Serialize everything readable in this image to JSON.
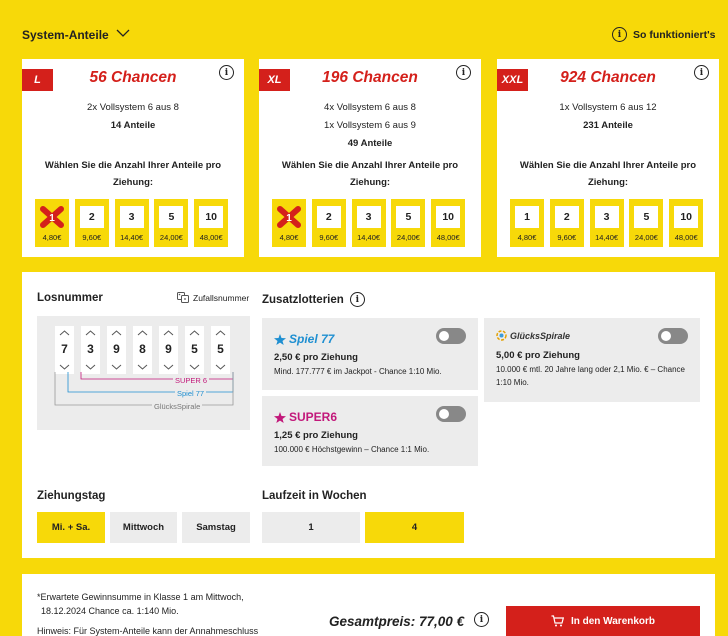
{
  "header": {
    "title": "System-Anteile",
    "howto_label": "So funktioniert's"
  },
  "cards": [
    {
      "badge": "L",
      "title": "56 Chancen",
      "lines": [
        "2x Vollsystem 6 aus 8"
      ],
      "shares_total": "14 Anteile",
      "question": "Wählen Sie die Anzahl Ihrer Anteile pro Ziehung:",
      "options": [
        {
          "n": "1",
          "price": "4,80€"
        },
        {
          "n": "2",
          "price": "9,60€"
        },
        {
          "n": "3",
          "price": "14,40€"
        },
        {
          "n": "5",
          "price": "24,00€"
        },
        {
          "n": "10",
          "price": "48,00€"
        }
      ]
    },
    {
      "badge": "XL",
      "title": "196 Chancen",
      "lines": [
        "4x Vollsystem 6 aus 8",
        "1x Vollsystem 6 aus 9"
      ],
      "shares_total": "49 Anteile",
      "question": "Wählen Sie die Anzahl Ihrer Anteile pro Ziehung:",
      "options": [
        {
          "n": "1",
          "price": "4,80€"
        },
        {
          "n": "2",
          "price": "9,60€"
        },
        {
          "n": "3",
          "price": "14,40€"
        },
        {
          "n": "5",
          "price": "24,00€"
        },
        {
          "n": "10",
          "price": "48,00€"
        }
      ]
    },
    {
      "badge": "XXL",
      "title": "924 Chancen",
      "lines": [
        "1x Vollsystem 6 aus 12"
      ],
      "shares_total": "231 Anteile",
      "question": "Wählen Sie die Anzahl Ihrer Anteile pro Ziehung:",
      "options": [
        {
          "n": "1",
          "price": "4,80€"
        },
        {
          "n": "2",
          "price": "9,60€"
        },
        {
          "n": "3",
          "price": "14,40€"
        },
        {
          "n": "5",
          "price": "24,00€"
        },
        {
          "n": "10",
          "price": "48,00€"
        }
      ]
    }
  ],
  "los": {
    "title": "Losnummer",
    "random_label": "Zufallsnummer",
    "digits": [
      "7",
      "3",
      "9",
      "8",
      "9",
      "5",
      "5"
    ],
    "super6": "SUPER 6",
    "spiel77": "Spiel 77",
    "gluecksspirale": "GlücksSpirale"
  },
  "zusatz": {
    "title": "Zusatzlotterien",
    "spiel77": {
      "name": "Spiel 77",
      "price": "2,50 € pro Ziehung",
      "desc": "Mind. 177.777 € im Jackpot - Chance 1:10 Mio."
    },
    "super6": {
      "name": "SUPER6",
      "price": "1,25 € pro Ziehung",
      "desc": "100.000 € Höchstgewinn – Chance 1:1 Mio."
    },
    "gluecksspirale": {
      "name": "GlücksSpirale",
      "price": "5,00 € pro Ziehung",
      "desc": "10.000 € mtl. 20 Jahre lang oder 2,1 Mio. € – Chance 1:10 Mio."
    }
  },
  "ziehungstag": {
    "title": "Ziehungstag",
    "options": [
      "Mi. + Sa.",
      "Mittwoch",
      "Samstag"
    ],
    "selected": "Mi. + Sa."
  },
  "laufzeit": {
    "title": "Laufzeit in Wochen",
    "options": [
      "1",
      "4"
    ],
    "selected": "4"
  },
  "footer": {
    "note1a": "*Erwartete Gewinnsumme in Klasse 1 am Mittwoch,",
    "note1b": "18.12.2024 Chance ca. 1:140 Mio.",
    "note2": "Hinweis: Für System-Anteile kann der Annahmeschluss",
    "total": "Gesamtpreis: 77,00 €",
    "cart_label": "In den Warenkorb"
  },
  "colors": {
    "yellow": "#f7d909",
    "red": "#d4201b",
    "spiel77_blue": "#1f8fd1",
    "super6_pink": "#c2187a"
  }
}
